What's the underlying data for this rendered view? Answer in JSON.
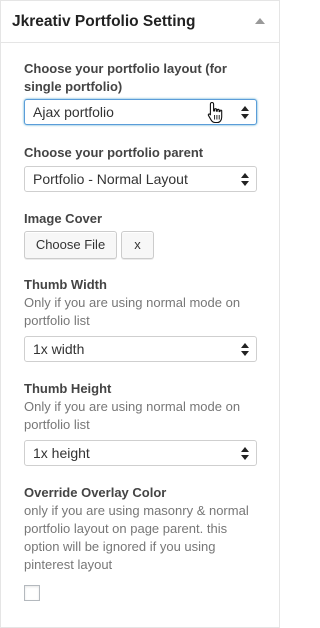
{
  "widget": {
    "title": "Jkreativ Portfolio Setting"
  },
  "layout_field": {
    "label_line1": "Choose your portfolio layout (for",
    "label_line2": "single portfolio)",
    "value": "Ajax portfolio"
  },
  "parent_field": {
    "label": "Choose your portfolio parent",
    "value": "Portfolio - Normal Layout"
  },
  "image_cover": {
    "label": "Image Cover",
    "choose_label": "Choose File",
    "clear_label": "x"
  },
  "thumb_width": {
    "label": "Thumb Width",
    "desc_line1": "Only if you are using normal mode on",
    "desc_line2": "portfolio list",
    "value": "1x width"
  },
  "thumb_height": {
    "label": "Thumb Height",
    "desc_line1": "Only if you are using normal mode on",
    "desc_line2": "portfolio list",
    "value": "1x height"
  },
  "overlay_color": {
    "label": "Override Overlay Color",
    "desc_line1": "only if you are using masonry & normal",
    "desc_line2": "portfolio layout on page parent. this",
    "desc_line3": "option will be ignored if you using",
    "desc_line4": "pinterest layout",
    "checked": false
  },
  "icons": {
    "toggle": "collapse-arrow-icon",
    "select_arrows": "select-arrows-icon",
    "cursor": "hand-pointer-icon"
  },
  "colors": {
    "focus_border": "#5b9dd9",
    "label_text": "#444444",
    "description_text": "#777777"
  }
}
